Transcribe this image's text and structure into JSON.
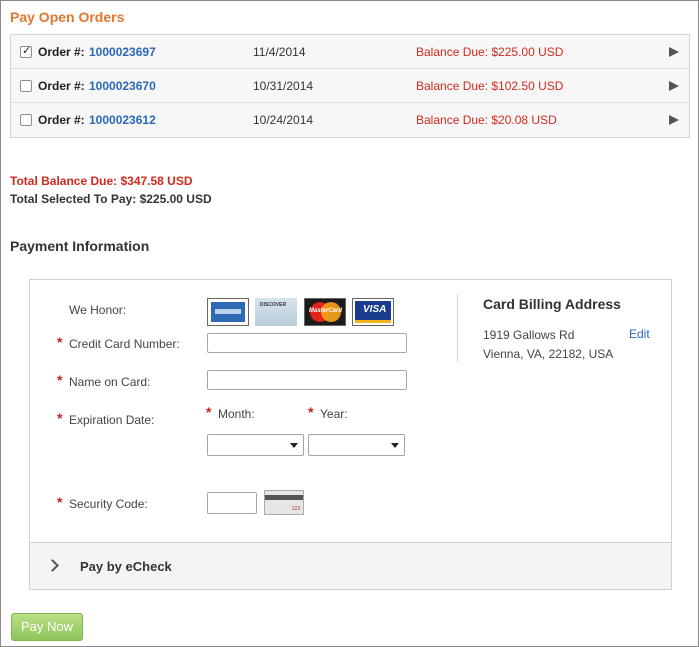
{
  "page_title": "Pay Open Orders",
  "orders": [
    {
      "label": "Order #:",
      "number": "1000023697",
      "date": "11/4/2014",
      "balance": "Balance Due: $225.00 USD",
      "checked": true
    },
    {
      "label": "Order #:",
      "number": "1000023670",
      "date": "10/31/2014",
      "balance": "Balance Due: $102.50 USD",
      "checked": false
    },
    {
      "label": "Order #:",
      "number": "1000023612",
      "date": "10/24/2014",
      "balance": "Balance Due: $20.08 USD",
      "checked": false
    }
  ],
  "totals": {
    "balance_due": "Total Balance Due: $347.58 USD",
    "selected": "Total Selected To Pay: $225.00 USD"
  },
  "payment": {
    "title": "Payment Information",
    "we_honor": "We Honor:",
    "cards": [
      "american-express-card-icon",
      "discover-card-icon",
      "mastercard-card-icon",
      "visa-card-icon"
    ],
    "card_text": {
      "discover": "DISCOVER",
      "mastercard": "MasterCard",
      "visa": "VISA",
      "cvv": "123"
    },
    "required_mark": "*",
    "cc_number_label": "Credit Card Number:",
    "cc_number_value": "",
    "name_label": "Name on Card:",
    "name_value": "",
    "expiration_label": "Expiration Date:",
    "month_label": "Month:",
    "month_value": "",
    "year_label": "Year:",
    "year_value": "",
    "security_label": "Security Code:",
    "security_value": ""
  },
  "billing": {
    "title": "Card Billing Address",
    "line1": "1919 Gallows Rd",
    "line2": "Vienna, VA, 22182, USA",
    "edit": "Edit"
  },
  "echeck": {
    "label": "Pay by eCheck"
  },
  "pay_button": "Pay Now",
  "colors": {
    "title_orange": "#e2772c",
    "link_blue": "#2a67b8",
    "balance_red": "#d12a1f",
    "button_green": "#8ec45a"
  }
}
